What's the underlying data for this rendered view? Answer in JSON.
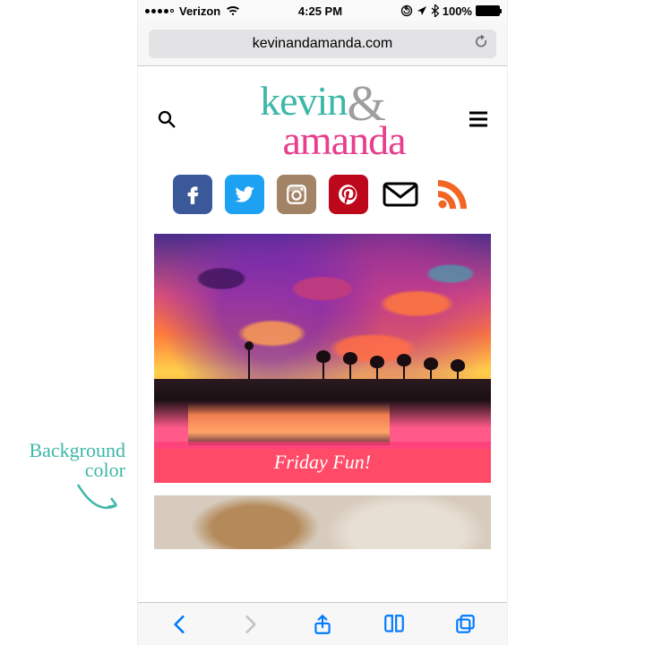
{
  "status": {
    "carrier": "Verizon",
    "time": "4:25 PM",
    "battery_pct": "100%"
  },
  "browser": {
    "url": "kevinandamanda.com"
  },
  "site": {
    "logo": {
      "word1": "kevin",
      "amp": "&",
      "word2": "amanda"
    },
    "social": [
      "facebook",
      "twitter",
      "instagram",
      "pinterest",
      "mail",
      "rss"
    ]
  },
  "post": {
    "title": "Friday Fun!"
  },
  "annotation": {
    "line1": "Background",
    "line2": "color"
  },
  "colors": {
    "teal": "#3db7a7",
    "pink": "#e83e8c",
    "grey": "#9e9e9e",
    "facebook": "#3b5998",
    "twitter": "#1da1f2",
    "instagram": "#a38366",
    "pinterest": "#bd081c",
    "rss": "#f26522",
    "ios_blue": "#007aff"
  }
}
